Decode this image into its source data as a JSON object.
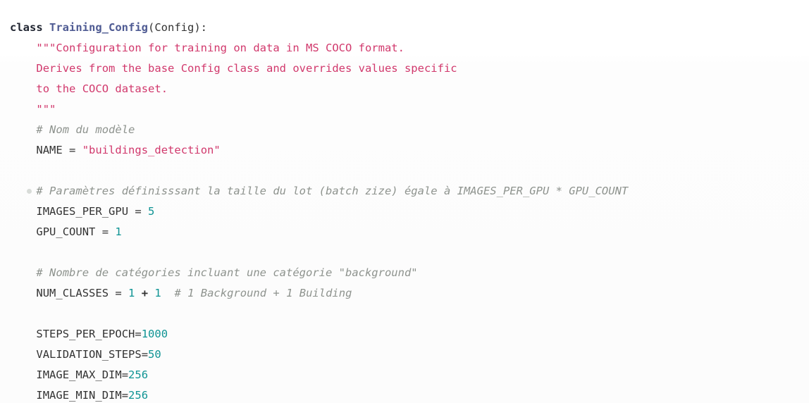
{
  "editor": {
    "language": "python",
    "background_color": "#ffffff",
    "theme_colors": {
      "keyword": "#1f2430",
      "class_name": "#4f5b93",
      "string": "#d1386c",
      "comment": "#8e938e",
      "number": "#0f9494",
      "plain_text": "#333333"
    },
    "gutter_marker": {
      "name": "fold-marker-dot",
      "color": "#d8dcd8",
      "on_line_index": 8
    }
  },
  "code": {
    "lines": [
      {
        "index": 0,
        "indent": 0,
        "tokens": [
          {
            "t": "keyword",
            "v": "class"
          },
          {
            "t": "plain",
            "v": " "
          },
          {
            "t": "classname",
            "v": "Training_Config"
          },
          {
            "t": "punct",
            "v": "(Config):"
          }
        ]
      },
      {
        "index": 1,
        "indent": 4,
        "tokens": [
          {
            "t": "string",
            "v": "\"\"\"Configuration for training on data in MS COCO format."
          }
        ]
      },
      {
        "index": 2,
        "indent": 4,
        "tokens": [
          {
            "t": "string",
            "v": "Derives from the base Config class and overrides values specific"
          }
        ]
      },
      {
        "index": 3,
        "indent": 4,
        "tokens": [
          {
            "t": "string",
            "v": "to the COCO dataset."
          }
        ]
      },
      {
        "index": 4,
        "indent": 4,
        "tokens": [
          {
            "t": "string",
            "v": "\"\"\""
          }
        ]
      },
      {
        "index": 5,
        "indent": 4,
        "tokens": [
          {
            "t": "comment",
            "v": "# Nom du modèle"
          }
        ]
      },
      {
        "index": 6,
        "indent": 4,
        "tokens": [
          {
            "t": "plain",
            "v": "NAME = "
          },
          {
            "t": "string",
            "v": "\"buildings_detection\""
          }
        ]
      },
      {
        "index": 7,
        "indent": 4,
        "tokens": []
      },
      {
        "index": 8,
        "indent": 4,
        "tokens": [
          {
            "t": "comment",
            "v": "# Paramètres définisssant la taille du lot (batch zize) égale à IMAGES_PER_GPU * GPU_COUNT"
          }
        ]
      },
      {
        "index": 9,
        "indent": 4,
        "tokens": [
          {
            "t": "plain",
            "v": "IMAGES_PER_GPU = "
          },
          {
            "t": "number",
            "v": "5"
          }
        ]
      },
      {
        "index": 10,
        "indent": 4,
        "tokens": [
          {
            "t": "plain",
            "v": "GPU_COUNT = "
          },
          {
            "t": "number",
            "v": "1"
          }
        ]
      },
      {
        "index": 11,
        "indent": 4,
        "tokens": []
      },
      {
        "index": 12,
        "indent": 4,
        "tokens": [
          {
            "t": "comment",
            "v": "# Nombre de catégories incluant une catégorie \"background\""
          }
        ]
      },
      {
        "index": 13,
        "indent": 4,
        "tokens": [
          {
            "t": "plain",
            "v": "NUM_CLASSES = "
          },
          {
            "t": "number",
            "v": "1"
          },
          {
            "t": "plain",
            "v": " "
          },
          {
            "t": "operator",
            "v": "+"
          },
          {
            "t": "plain",
            "v": " "
          },
          {
            "t": "number",
            "v": "1"
          },
          {
            "t": "plain",
            "v": "  "
          },
          {
            "t": "comment",
            "v": "# 1 Background + 1 Building"
          }
        ]
      },
      {
        "index": 14,
        "indent": 4,
        "tokens": []
      },
      {
        "index": 15,
        "indent": 4,
        "tokens": [
          {
            "t": "plain",
            "v": "STEPS_PER_EPOCH="
          },
          {
            "t": "number",
            "v": "1000"
          }
        ]
      },
      {
        "index": 16,
        "indent": 4,
        "tokens": [
          {
            "t": "plain",
            "v": "VALIDATION_STEPS="
          },
          {
            "t": "number",
            "v": "50"
          }
        ]
      },
      {
        "index": 17,
        "indent": 4,
        "tokens": [
          {
            "t": "plain",
            "v": "IMAGE_MAX_DIM="
          },
          {
            "t": "number",
            "v": "256"
          }
        ]
      },
      {
        "index": 18,
        "indent": 4,
        "tokens": [
          {
            "t": "plain",
            "v": "IMAGE_MIN_DIM="
          },
          {
            "t": "number",
            "v": "256"
          }
        ]
      }
    ]
  }
}
